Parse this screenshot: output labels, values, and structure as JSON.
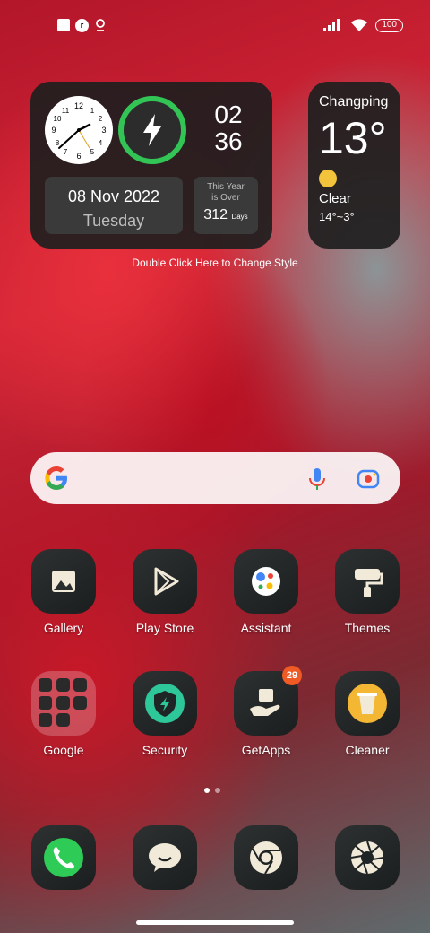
{
  "status_bar": {
    "battery": "100"
  },
  "clock_widget": {
    "time_hours": "02",
    "time_minutes": "36",
    "date": "08 Nov 2022",
    "weekday": "Tuesday",
    "year_over_label_1": "This Year",
    "year_over_label_2": "is Over",
    "days_count": "312",
    "days_unit": "Days"
  },
  "weather_widget": {
    "city": "Changping",
    "temperature": "13°",
    "condition": "Clear",
    "range": "14°~3°"
  },
  "hint": "Double Click Here to Change Style",
  "apps_row1": [
    {
      "label": "Gallery"
    },
    {
      "label": "Play Store"
    },
    {
      "label": "Assistant"
    },
    {
      "label": "Themes"
    }
  ],
  "apps_row2": [
    {
      "label": "Google"
    },
    {
      "label": "Security"
    },
    {
      "label": "GetApps",
      "badge": "29"
    },
    {
      "label": "Cleaner"
    }
  ],
  "colors": {
    "charge_ring": "#33c456",
    "badge": "#f05a25",
    "phone_green": "#2ecc57"
  }
}
